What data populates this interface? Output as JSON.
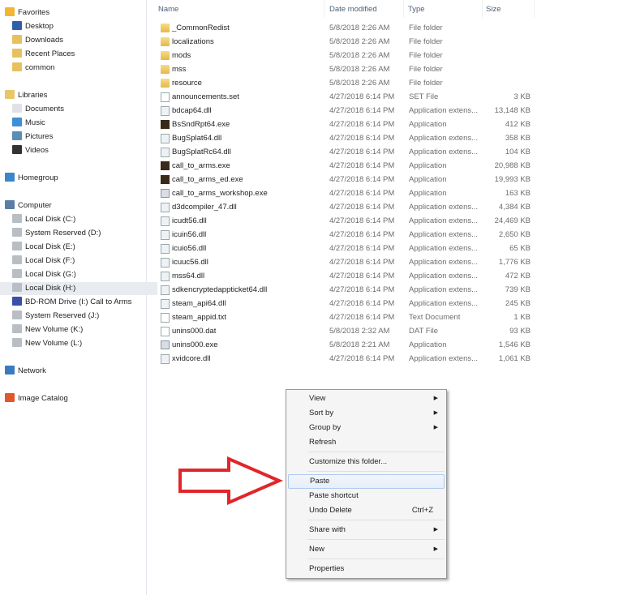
{
  "sidebar": {
    "favorites": {
      "label": "Favorites",
      "items": [
        "Desktop",
        "Downloads",
        "Recent Places",
        "common"
      ]
    },
    "libraries": {
      "label": "Libraries",
      "items": [
        "Documents",
        "Music",
        "Pictures",
        "Videos"
      ]
    },
    "homegroup": "Homegroup",
    "computer": {
      "label": "Computer",
      "items": [
        "Local Disk (C:)",
        "System Reserved (D:)",
        "Local Disk (E:)",
        "Local Disk (F:)",
        "Local Disk (G:)",
        "Local Disk (H:)",
        "BD-ROM Drive (I:) Call to Arms",
        "System Reserved (J:)",
        "New Volume (K:)",
        "New Volume (L:)"
      ],
      "selected": "Local Disk (H:)"
    },
    "network": "Network",
    "image_catalog": "Image Catalog"
  },
  "columns": {
    "name": "Name",
    "date": "Date modified",
    "type": "Type",
    "size": "Size"
  },
  "files": [
    {
      "name": "_CommonRedist",
      "date": "5/8/2018 2:26 AM",
      "type": "File folder",
      "size": "",
      "icon": "folder"
    },
    {
      "name": "localizations",
      "date": "5/8/2018 2:26 AM",
      "type": "File folder",
      "size": "",
      "icon": "folder"
    },
    {
      "name": "mods",
      "date": "5/8/2018 2:26 AM",
      "type": "File folder",
      "size": "",
      "icon": "folder"
    },
    {
      "name": "mss",
      "date": "5/8/2018 2:26 AM",
      "type": "File folder",
      "size": "",
      "icon": "folder"
    },
    {
      "name": "resource",
      "date": "5/8/2018 2:26 AM",
      "type": "File folder",
      "size": "",
      "icon": "folder"
    },
    {
      "name": "announcements.set",
      "date": "4/27/2018 6:14 PM",
      "type": "SET File",
      "size": "3 KB",
      "icon": "file"
    },
    {
      "name": "bdcap64.dll",
      "date": "4/27/2018 6:14 PM",
      "type": "Application extens...",
      "size": "13,148 KB",
      "icon": "dll"
    },
    {
      "name": "BsSndRpt64.exe",
      "date": "4/27/2018 6:14 PM",
      "type": "Application",
      "size": "412 KB",
      "icon": "app"
    },
    {
      "name": "BugSplat64.dll",
      "date": "4/27/2018 6:14 PM",
      "type": "Application extens...",
      "size": "358 KB",
      "icon": "dll"
    },
    {
      "name": "BugSplatRc64.dll",
      "date": "4/27/2018 6:14 PM",
      "type": "Application extens...",
      "size": "104 KB",
      "icon": "dll"
    },
    {
      "name": "call_to_arms.exe",
      "date": "4/27/2018 6:14 PM",
      "type": "Application",
      "size": "20,988 KB",
      "icon": "app"
    },
    {
      "name": "call_to_arms_ed.exe",
      "date": "4/27/2018 6:14 PM",
      "type": "Application",
      "size": "19,993 KB",
      "icon": "app"
    },
    {
      "name": "call_to_arms_workshop.exe",
      "date": "4/27/2018 6:14 PM",
      "type": "Application",
      "size": "163 KB",
      "icon": "exe"
    },
    {
      "name": "d3dcompiler_47.dll",
      "date": "4/27/2018 6:14 PM",
      "type": "Application extens...",
      "size": "4,384 KB",
      "icon": "dll"
    },
    {
      "name": "icudt56.dll",
      "date": "4/27/2018 6:14 PM",
      "type": "Application extens...",
      "size": "24,469 KB",
      "icon": "dll"
    },
    {
      "name": "icuin56.dll",
      "date": "4/27/2018 6:14 PM",
      "type": "Application extens...",
      "size": "2,650 KB",
      "icon": "dll"
    },
    {
      "name": "icuio56.dll",
      "date": "4/27/2018 6:14 PM",
      "type": "Application extens...",
      "size": "65 KB",
      "icon": "dll"
    },
    {
      "name": "icuuc56.dll",
      "date": "4/27/2018 6:14 PM",
      "type": "Application extens...",
      "size": "1,776 KB",
      "icon": "dll"
    },
    {
      "name": "mss64.dll",
      "date": "4/27/2018 6:14 PM",
      "type": "Application extens...",
      "size": "472 KB",
      "icon": "dll"
    },
    {
      "name": "sdkencryptedappticket64.dll",
      "date": "4/27/2018 6:14 PM",
      "type": "Application extens...",
      "size": "739 KB",
      "icon": "dll"
    },
    {
      "name": "steam_api64.dll",
      "date": "4/27/2018 6:14 PM",
      "type": "Application extens...",
      "size": "245 KB",
      "icon": "dll"
    },
    {
      "name": "steam_appid.txt",
      "date": "4/27/2018 6:14 PM",
      "type": "Text Document",
      "size": "1 KB",
      "icon": "file"
    },
    {
      "name": "unins000.dat",
      "date": "5/8/2018 2:32 AM",
      "type": "DAT File",
      "size": "93 KB",
      "icon": "file"
    },
    {
      "name": "unins000.exe",
      "date": "5/8/2018 2:21 AM",
      "type": "Application",
      "size": "1,546 KB",
      "icon": "exe"
    },
    {
      "name": "xvidcore.dll",
      "date": "4/27/2018 6:14 PM",
      "type": "Application extens...",
      "size": "1,061 KB",
      "icon": "dll"
    }
  ],
  "context_menu": {
    "items": [
      {
        "label": "View",
        "submenu": true
      },
      {
        "label": "Sort by",
        "submenu": true
      },
      {
        "label": "Group by",
        "submenu": true
      },
      {
        "label": "Refresh"
      },
      {
        "sep": true
      },
      {
        "label": "Customize this folder..."
      },
      {
        "sep": true
      },
      {
        "label": "Paste",
        "highlighted": true
      },
      {
        "label": "Paste shortcut"
      },
      {
        "label": "Undo Delete",
        "shortcut": "Ctrl+Z"
      },
      {
        "sep": true
      },
      {
        "label": "Share with",
        "submenu": true
      },
      {
        "sep": true
      },
      {
        "label": "New",
        "submenu": true
      },
      {
        "sep": true
      },
      {
        "label": "Properties"
      }
    ]
  },
  "colors": {
    "arrow": "#e0262b",
    "highlight": "#e6eef8"
  }
}
